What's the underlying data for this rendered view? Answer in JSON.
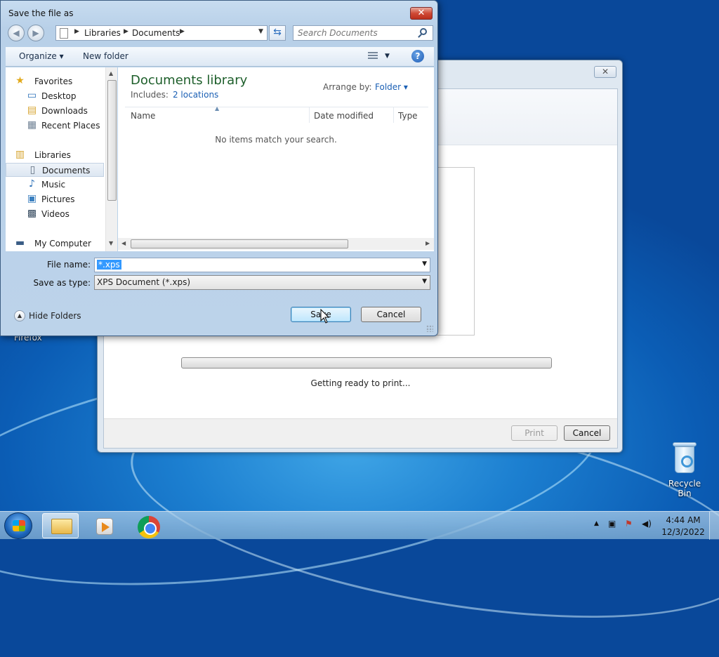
{
  "desktop": {
    "recycle_bin_label": "Recycle Bin",
    "firefox_label": "Firefox"
  },
  "print_dialog": {
    "close_glyph": "✕",
    "status_text": "Getting ready to print...",
    "print_button": "Print",
    "cancel_button": "Cancel",
    "progress": 0
  },
  "save_dialog": {
    "title": "Save the file as",
    "close_glyph": "✕",
    "address": {
      "crumbs": [
        "Libraries",
        "Documents"
      ]
    },
    "search_placeholder": "Search Documents",
    "toolbar": {
      "organize": "Organize ▾",
      "new_folder": "New folder"
    },
    "nav": {
      "items": [
        {
          "label": "Favorites",
          "icon": "star-icon",
          "glyph": "★"
        },
        {
          "label": "Desktop",
          "icon": "desktop-icon",
          "glyph": "▭"
        },
        {
          "label": "Downloads",
          "icon": "downloads-folder-icon",
          "glyph": "▤"
        },
        {
          "label": "Recent Places",
          "icon": "recent-places-icon",
          "glyph": "▦"
        },
        {
          "label": "Libraries",
          "icon": "libraries-icon",
          "glyph": "▥"
        },
        {
          "label": "Documents",
          "icon": "documents-icon",
          "glyph": "▯"
        },
        {
          "label": "Music",
          "icon": "music-icon",
          "glyph": "♪"
        },
        {
          "label": "Pictures",
          "icon": "pictures-icon",
          "glyph": "▣"
        },
        {
          "label": "Videos",
          "icon": "videos-icon",
          "glyph": "▩"
        },
        {
          "label": "My Computer",
          "icon": "computer-icon",
          "glyph": "▬"
        }
      ]
    },
    "library": {
      "title": "Documents library",
      "includes_label": "Includes:",
      "includes_link": "2 locations",
      "arrange_label": "Arrange by:",
      "arrange_value": "Folder ▾"
    },
    "columns": [
      "Name",
      "Date modified",
      "Type"
    ],
    "empty_message": "No items match your search.",
    "file_name_label": "File name:",
    "file_name_value": "*.xps",
    "save_type_label": "Save as type:",
    "save_type_value": "XPS Document (*.xps)",
    "hide_folders": "Hide Folders",
    "save_button": "Save",
    "cancel_button": "Cancel"
  },
  "taskbar": {
    "time": "4:44 AM",
    "date": "12/3/2022"
  }
}
